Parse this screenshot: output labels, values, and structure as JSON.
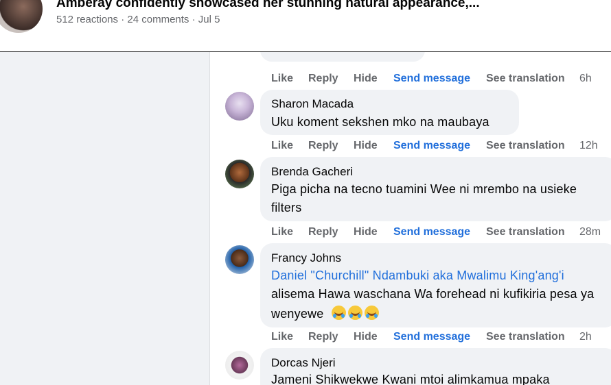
{
  "post": {
    "title": "Amberay confidently showcased her stunning natural appearance,...",
    "meta": "512 reactions · 24 comments · Jul 5"
  },
  "actions": {
    "like": "Like",
    "reply": "Reply",
    "hide": "Hide",
    "send": "Send message",
    "translate": "See translation"
  },
  "comments": [
    {
      "time": "6h"
    },
    {
      "author": "Sharon Macada",
      "lines": [
        "Uku koment sekshen mko na maubaya"
      ],
      "time": "12h"
    },
    {
      "author": "Brenda Gacheri",
      "lines": [
        "Piga picha na tecno tuamini Wee ni mrembo na usieke",
        "filters"
      ],
      "time": "28m"
    },
    {
      "author": "Francy Johns",
      "mention": "Daniel \"Churchill\" Ndambuki aka Mwalimu King'ang'i",
      "lines": [
        "alisema Hawa waschana Wa forehead ni kufikiria pesa ya",
        "wenyewe"
      ],
      "emoji": "😂😂😂",
      "time": "2h"
    },
    {
      "author": "Dorcas Njeri",
      "lines": [
        "Jameni Shikwekwe Kwani mtoi alimkamua mpaka"
      ]
    }
  ],
  "icons": {
    "avatars": "user-avatar-icon",
    "emoji": "face-with-tears-of-joy-icon"
  }
}
